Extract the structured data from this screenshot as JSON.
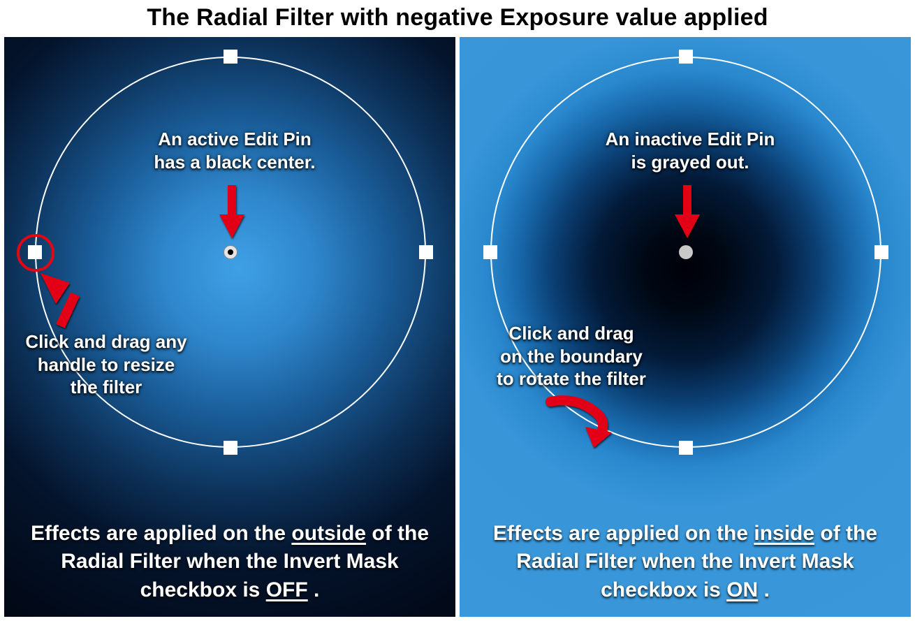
{
  "title": "The Radial Filter with negative Exposure value applied",
  "left": {
    "pin_label": "An active Edit Pin\nhas a black center.",
    "handle_label": "Click and drag any\nhandle to resize\nthe filter",
    "caption_prefix": "Effects are applied on the",
    "caption_word": "outside",
    "caption_mid": " of the Radial Filter when the Invert Mask checkbox is ",
    "caption_state": "OFF",
    "caption_suffix": "."
  },
  "right": {
    "pin_label": "An inactive Edit Pin\nis grayed out.",
    "rotate_label": "Click and drag\non the boundary\nto rotate the filter",
    "caption_prefix": "Effects are applied on the",
    "caption_word": "inside",
    "caption_mid": " of the Radial Filter when the Invert Mask checkbox is ",
    "caption_state": "ON",
    "caption_suffix": "."
  },
  "colors": {
    "accent_red": "#e30613",
    "handle_white": "#ffffff"
  }
}
